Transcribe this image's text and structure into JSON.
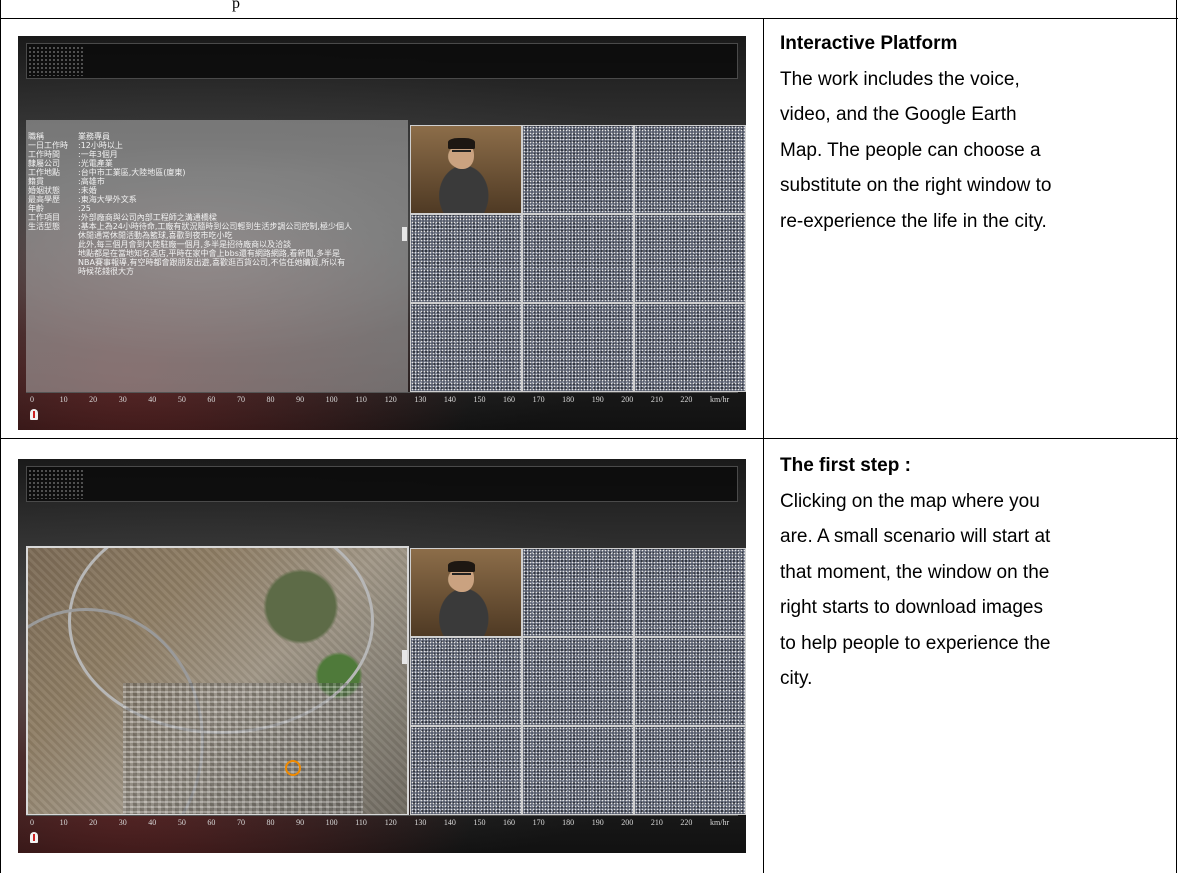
{
  "top_caption": "p",
  "rows": [
    {
      "title": "Interactive Platform",
      "body_lines": [
        "The work includes the voice,",
        "video, and the Google Earth",
        "Map. The people can choose a",
        "substitute on the right window to",
        "re-experience the life in the city."
      ],
      "screenshot": {
        "info_rows": [
          {
            "k": "職稱",
            "v": "業務專員"
          },
          {
            "k": "一日工作時",
            "v": ":12小時以上"
          },
          {
            "k": "工作時間",
            "v": ":一年3個月"
          },
          {
            "k": "隸屬公司",
            "v": ":光電產業"
          },
          {
            "k": "工作地點",
            "v": ":台中市工業區,大陸地區(廈東)"
          },
          {
            "k": "籍貫",
            "v": ":高雄市"
          },
          {
            "k": "婚姻狀態",
            "v": ":未婚"
          },
          {
            "k": "最高學歷",
            "v": ":東海大學外文系"
          },
          {
            "k": "年齡",
            "v": ":25"
          },
          {
            "k": "工作項目",
            "v": ":外部廠商與公司內部工程師之溝通橋樑"
          },
          {
            "k": "生活型態",
            "v": ":基本上為24小時待命,工廠有狀況隨時到公司輕到生活步調公司控制,極少個人"
          },
          {
            "k": "",
            "v": "休閒通常休閒活動為籃球,喜歡到夜市吃小吃"
          },
          {
            "k": "",
            "v": "此外,每三個月會到大陸駐廠一個月,多半是招待廠商以及洽談"
          },
          {
            "k": "",
            "v": "地點都是在當地知名酒店,平時在家中會上bbs還有網路網路,看新聞,多半是"
          },
          {
            "k": "",
            "v": "NBA賽事報導,有空時都會跟朋友出遊,喜歡逛百貨公司,不信任她購買,所以有"
          },
          {
            "k": "",
            "v": "時候花錢很大方"
          }
        ]
      }
    },
    {
      "title": "The first step :",
      "body_lines": [
        "Clicking on the map where you",
        "are. A small scenario will start at",
        "that moment, the window on the",
        "right starts to download images",
        "to help people to experience the",
        "city."
      ]
    }
  ],
  "speed_ticks": [
    "0",
    "10",
    "20",
    "30",
    "40",
    "50",
    "60",
    "70",
    "80",
    "90",
    "100",
    "110",
    "120",
    "130",
    "140",
    "150",
    "160",
    "170",
    "180",
    "190",
    "200",
    "210",
    "220",
    "km/hr"
  ],
  "colors": {
    "map_marker": "#f08a00",
    "needle_tip": "#cc2222"
  }
}
